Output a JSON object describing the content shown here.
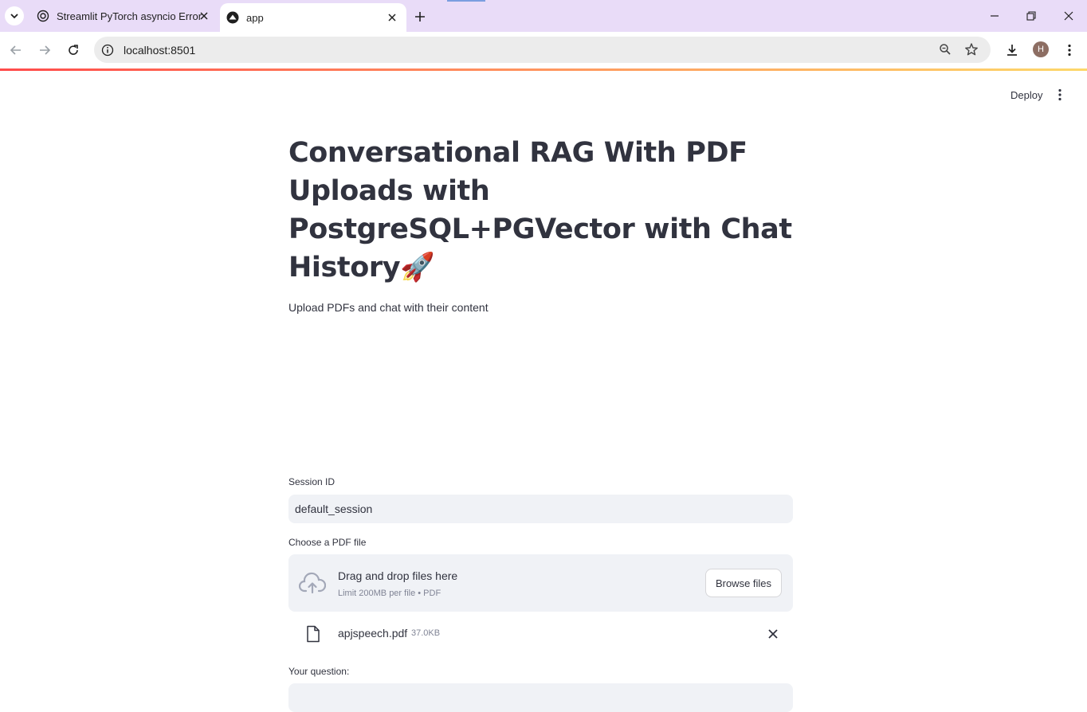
{
  "browser": {
    "tabs": [
      {
        "title": "Streamlit PyTorch asyncio Error",
        "icon": "openai-icon",
        "active": false
      },
      {
        "title": "app",
        "icon": "streamlit-icon",
        "active": true
      }
    ],
    "url": "localhost:8501",
    "profile_initial": "H",
    "colors": {
      "tabbar": "#e9dcf8",
      "omnibox": "#ececec"
    }
  },
  "header": {
    "deploy_label": "Deploy"
  },
  "main": {
    "title": "Conversational RAG With PDF Uploads with PostgreSQL+PGVector with Chat History",
    "title_emoji": "🚀",
    "subtitle": "Upload PDFs and chat with their content",
    "session": {
      "label": "Session ID",
      "value": "default_session"
    },
    "uploader": {
      "label": "Choose a PDF file",
      "drop_text": "Drag and drop files here",
      "limit_text": "Limit 200MB per file • PDF",
      "browse_label": "Browse files",
      "file": {
        "name": "apjspeech.pdf",
        "size": "37.0KB"
      }
    },
    "question": {
      "label": "Your question:",
      "value": ""
    }
  },
  "colors": {
    "text": "#31333f",
    "input_bg": "#f0f2f6",
    "muted": "#808495",
    "accent_gradient": [
      "#ff4b4b",
      "#fdd86a"
    ]
  }
}
